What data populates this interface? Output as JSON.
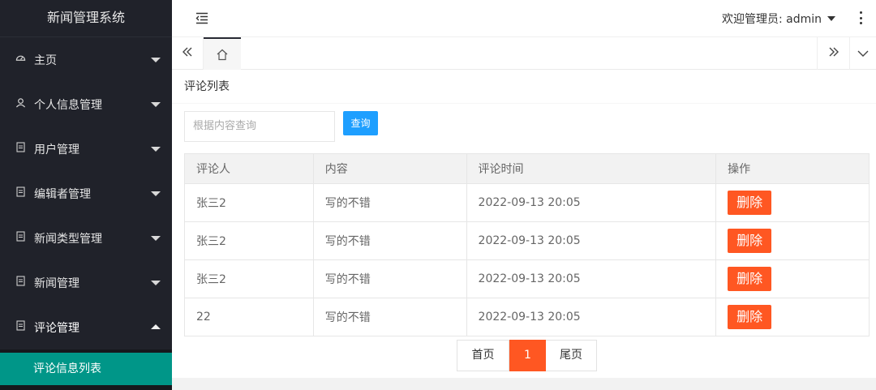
{
  "app": {
    "title": "新闻管理系统"
  },
  "sidebar": {
    "items": [
      {
        "label": "主页",
        "icon": "dashboard-icon"
      },
      {
        "label": "个人信息管理",
        "icon": "user-icon"
      },
      {
        "label": "用户管理",
        "icon": "file-icon"
      },
      {
        "label": "编辑者管理",
        "icon": "file-icon"
      },
      {
        "label": "新闻类型管理",
        "icon": "file-icon"
      },
      {
        "label": "新闻管理",
        "icon": "file-icon"
      },
      {
        "label": "评论管理",
        "icon": "file-icon"
      }
    ],
    "subitem": "评论信息列表"
  },
  "header": {
    "welcome": "欢迎管理员: admin"
  },
  "page": {
    "title": "评论列表",
    "search_placeholder": "根据内容查询",
    "search_button": "查询"
  },
  "table": {
    "columns": [
      "评论人",
      "内容",
      "评论时间",
      "操作"
    ],
    "rows": [
      {
        "user": "张三2",
        "content": "写的不错",
        "time": "2022-09-13 20:05",
        "action": "删除"
      },
      {
        "user": "张三2",
        "content": "写的不错",
        "time": "2022-09-13 20:05",
        "action": "删除"
      },
      {
        "user": "张三2",
        "content": "写的不错",
        "time": "2022-09-13 20:05",
        "action": "删除"
      },
      {
        "user": "22",
        "content": "写的不错",
        "time": "2022-09-13 20:05",
        "action": "删除"
      }
    ]
  },
  "pager": {
    "first": "首页",
    "current": "1",
    "last": "尾页"
  },
  "colors": {
    "accent": "#009688",
    "danger": "#ff5722",
    "primary": "#1e9fff",
    "sidebar": "#20222a"
  }
}
